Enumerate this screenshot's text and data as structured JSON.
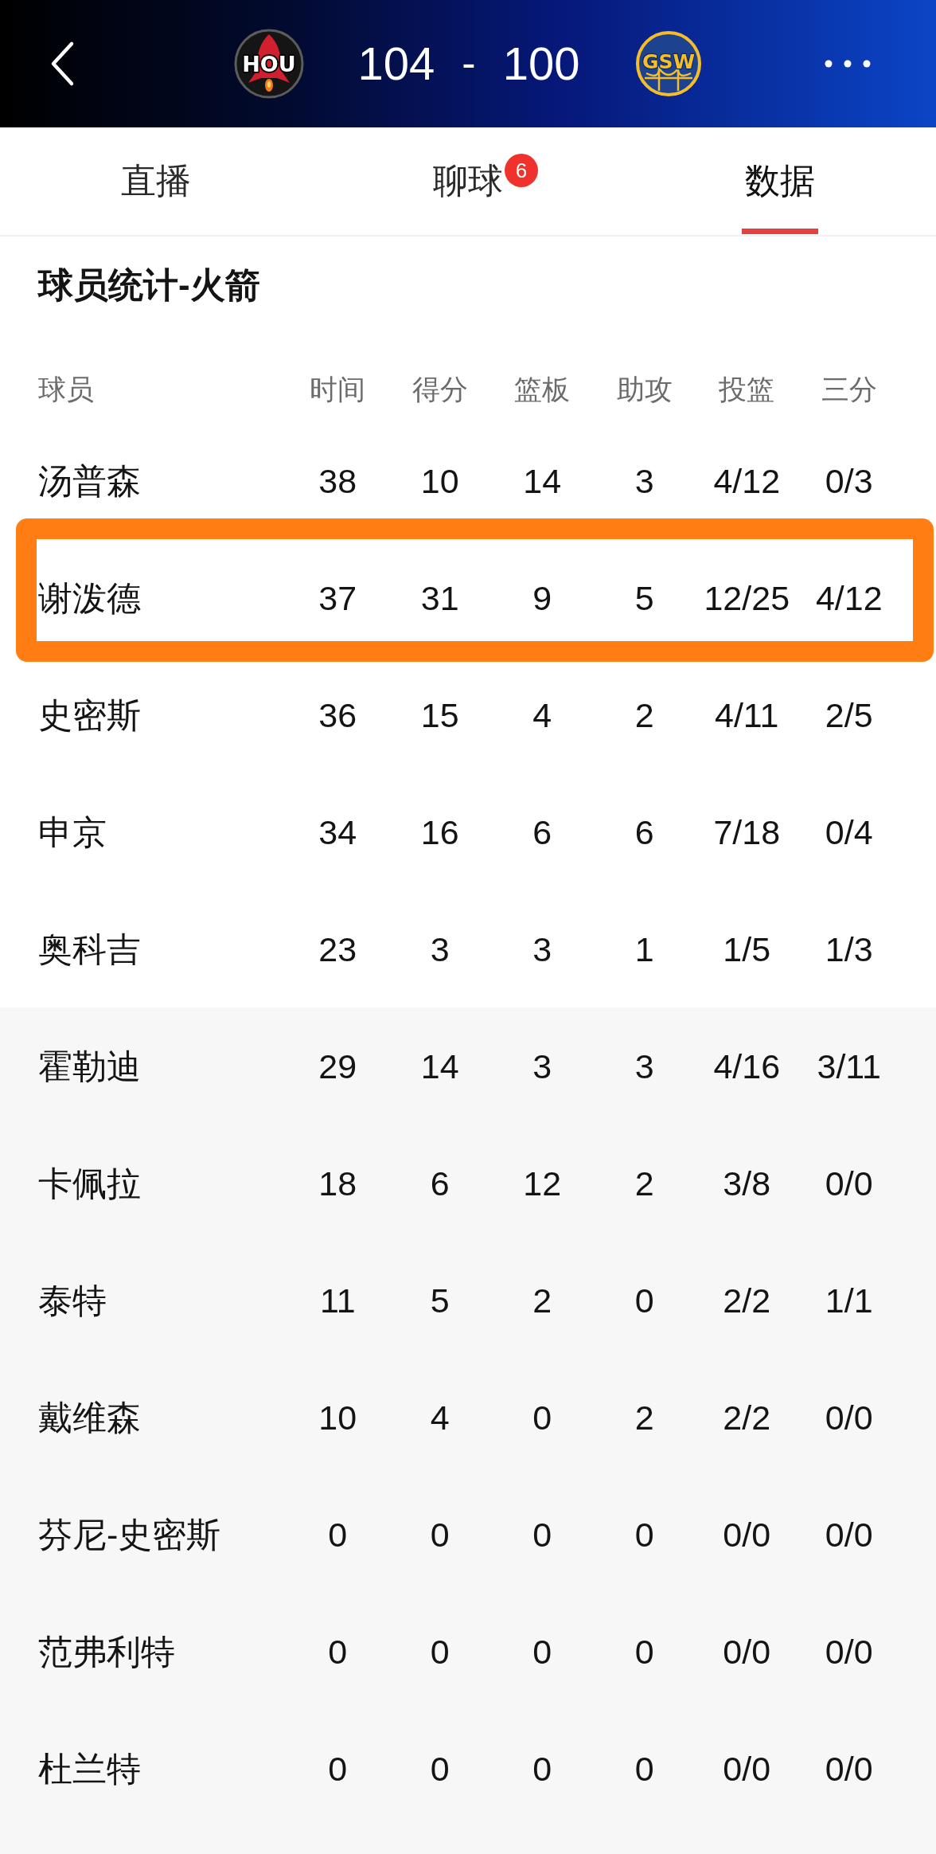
{
  "header": {
    "home_team": {
      "abbr": "HOU"
    },
    "score": {
      "home": "104",
      "separator": "-",
      "away": "100"
    },
    "away_team": {
      "abbr": "GSW"
    }
  },
  "tabs": [
    {
      "label": "直播",
      "selected": false
    },
    {
      "label": "聊球",
      "selected": false,
      "badge": "6"
    },
    {
      "label": "数据",
      "selected": true
    }
  ],
  "section_title": "球员统计-火箭",
  "table": {
    "columns": [
      "球员",
      "时间",
      "得分",
      "篮板",
      "助攻",
      "投篮",
      "三分"
    ],
    "starters": [
      {
        "cells": [
          "汤普森",
          "38",
          "10",
          "14",
          "3",
          "4/12",
          "0/3"
        ],
        "highlighted": false
      },
      {
        "cells": [
          "谢泼德",
          "37",
          "31",
          "9",
          "5",
          "12/25",
          "4/12"
        ],
        "highlighted": true
      },
      {
        "cells": [
          "史密斯",
          "36",
          "15",
          "4",
          "2",
          "4/11",
          "2/5"
        ],
        "highlighted": false
      },
      {
        "cells": [
          "申京",
          "34",
          "16",
          "6",
          "6",
          "7/18",
          "0/4"
        ],
        "highlighted": false
      },
      {
        "cells": [
          "奥科吉",
          "23",
          "3",
          "3",
          "1",
          "1/5",
          "1/3"
        ],
        "highlighted": false
      }
    ],
    "bench": [
      {
        "cells": [
          "霍勒迪",
          "29",
          "14",
          "3",
          "3",
          "4/16",
          "3/11"
        ],
        "highlighted": false
      },
      {
        "cells": [
          "卡佩拉",
          "18",
          "6",
          "12",
          "2",
          "3/8",
          "0/0"
        ],
        "highlighted": false
      },
      {
        "cells": [
          "泰特",
          "11",
          "5",
          "2",
          "0",
          "2/2",
          "1/1"
        ],
        "highlighted": false
      },
      {
        "cells": [
          "戴维森",
          "10",
          "4",
          "0",
          "2",
          "2/2",
          "0/0"
        ],
        "highlighted": false
      },
      {
        "cells": [
          "芬尼-史密斯",
          "0",
          "0",
          "0",
          "0",
          "0/0",
          "0/0"
        ],
        "highlighted": false
      },
      {
        "cells": [
          "范弗利特",
          "0",
          "0",
          "0",
          "0",
          "0/0",
          "0/0"
        ],
        "highlighted": false
      },
      {
        "cells": [
          "杜兰特",
          "0",
          "0",
          "0",
          "0",
          "0/0",
          "0/0"
        ],
        "highlighted": false
      }
    ]
  }
}
